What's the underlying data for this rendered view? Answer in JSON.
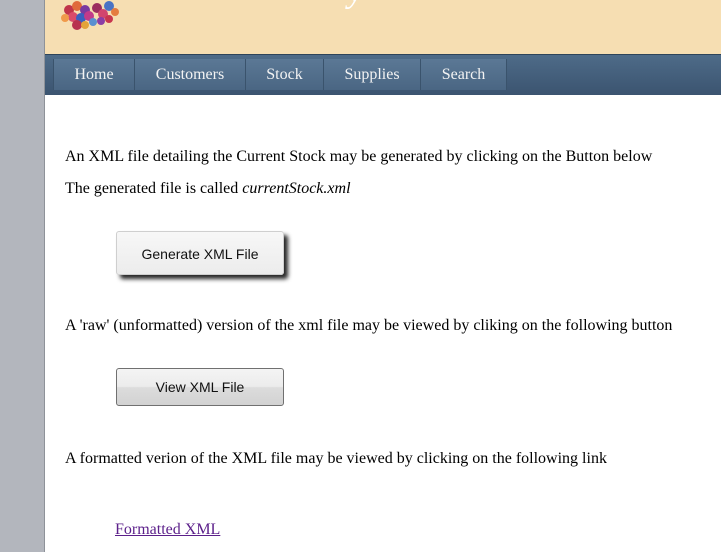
{
  "nav": {
    "items": [
      {
        "label": "Home"
      },
      {
        "label": "Customers"
      },
      {
        "label": "Stock"
      },
      {
        "label": "Supplies"
      },
      {
        "label": "Search"
      }
    ]
  },
  "content": {
    "intro_text": "An XML file detailing the Current Stock may be generated by clicking on the Button below",
    "filename_prefix": "The generated file is called ",
    "filename": "currentStock.xml",
    "generate_button_label": "Generate XML File",
    "raw_text": "A 'raw' (unformatted) version of the xml file may be viewed by cliking on the following button",
    "view_button_label": "View XML File",
    "formatted_text": "A formatted verion of the XML file may be viewed by clicking on the following link",
    "formatted_link_label": "Formatted XML"
  },
  "colors": {
    "banner": "#f6deb2",
    "navbar": "#3b5470",
    "link_visited": "#5b1f8a"
  }
}
